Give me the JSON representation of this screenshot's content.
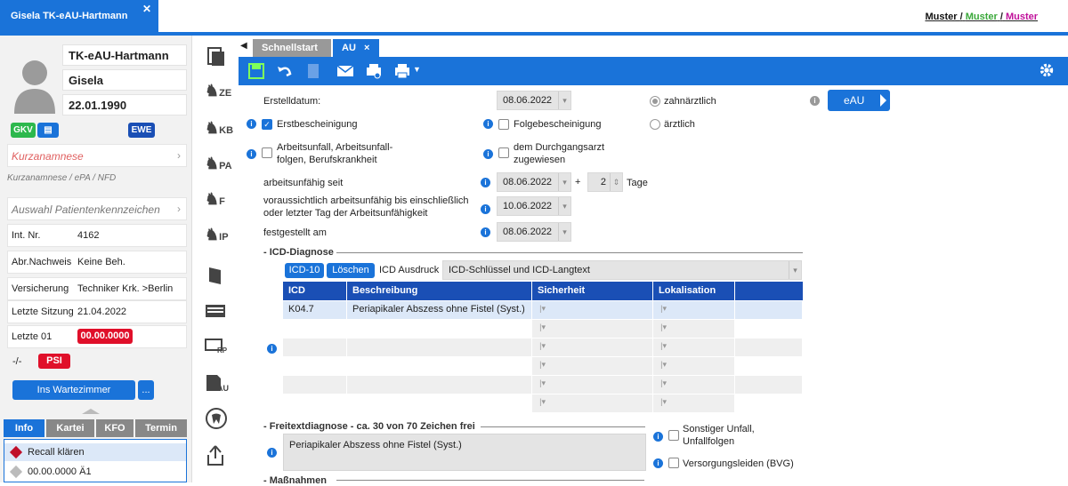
{
  "top": {
    "patient_tab": "Gisela TK-eAU-Hartmann",
    "muster1": "Muster",
    "muster2": "Muster",
    "muster3": "Muster",
    "sep": "/"
  },
  "patient": {
    "last_name": "TK-eAU-Hartmann",
    "first_name": "Gisela",
    "birthdate": "22.01.1990",
    "badge_gkv": "GKV",
    "badge_ewe": "EWE",
    "kurzanamnese": "Kurzanamnese",
    "kurz_sub": "Kurzanamnese  /  ePA  /  NFD",
    "auswahl": "Auswahl Patientenkennzeichen",
    "rows": [
      {
        "label": "Int. Nr.",
        "value": "4162"
      },
      {
        "label": "Abr.Nachweis",
        "value": "Keine Beh."
      },
      {
        "label": "Versicherung",
        "value": "Techniker Krk. >Berlin"
      },
      {
        "label": "Letzte Sitzung",
        "value": "21.04.2022"
      },
      {
        "label": "Letzte 01",
        "value": "00.00.0000"
      }
    ],
    "dash": "-/-",
    "psi": "PSI",
    "wartezimmer": "Ins Wartezimmer",
    "more": "...",
    "bottom_tabs": [
      "Info",
      "Kartei",
      "KFO",
      "Termin"
    ],
    "info_items": [
      "Recall klären",
      "00.00.0000 Ä1"
    ]
  },
  "nav_icons": [
    "ZE",
    "KB",
    "PA",
    "F",
    "IP",
    "",
    "",
    "RP",
    "AU",
    "",
    ""
  ],
  "tabs": {
    "schnellstart": "Schnellstart",
    "au": "AU",
    "close": "×"
  },
  "form": {
    "erstelldatum_label": "Erstelldatum:",
    "erstelldatum": "08.06.2022",
    "zahnaerztlich": "zahnärztlich",
    "aerztlich": "ärztlich",
    "eau": "eAU",
    "erstbescheinigung": "Erstbescheinigung",
    "folgebescheinigung": "Folgebescheinigung",
    "arbeitsunfall_1": "Arbeitsunfall, Arbeitsunfall-",
    "arbeitsunfall_2": "folgen, Berufskrankheit",
    "durchgang_1": "dem Durchgangsarzt",
    "durchgang_2": "zugewiesen",
    "seit_label": "arbeitsunfähig seit",
    "seit": "08.06.2022",
    "plus": "+",
    "tage_num": "2",
    "tage": "Tage",
    "bis_label_1": "voraussichtlich arbeitsunfähig bis einschließlich",
    "bis_label_2": "oder letzter Tag der Arbeitsunfähigkeit",
    "bis": "10.06.2022",
    "festgestellt_label": "festgestellt am",
    "festgestellt": "08.06.2022",
    "icd_section": "ICD-Diagnose",
    "icd10_btn": "ICD-10",
    "loeschen_btn": "Löschen",
    "icd_ausdruck": "ICD Ausdruck",
    "icd_ausdruck_value": "ICD-Schlüssel und ICD-Langtext",
    "cols": [
      "ICD",
      "Beschreibung",
      "Sicherheit",
      "Lokalisation"
    ],
    "rows": [
      {
        "icd": "K04.7",
        "desc": "Periapikaler Abszess ohne Fistel (Syst.)"
      }
    ],
    "freitext_section": "Freitextdiagnose - ca. 30 von 70 Zeichen frei",
    "freitext": "Periapikaler Abszess ohne Fistel (Syst.)",
    "sonstiger_1": "Sonstiger Unfall,",
    "sonstiger_2": "Unfallfolgen",
    "versorgung": "Versorgungsleiden (BVG)",
    "massnahmen": "Maßnahmen"
  },
  "colors": {
    "accent": "#1a73d9",
    "header": "#1a4fb5",
    "psi": "#e0102a",
    "green": "#2db84d"
  }
}
